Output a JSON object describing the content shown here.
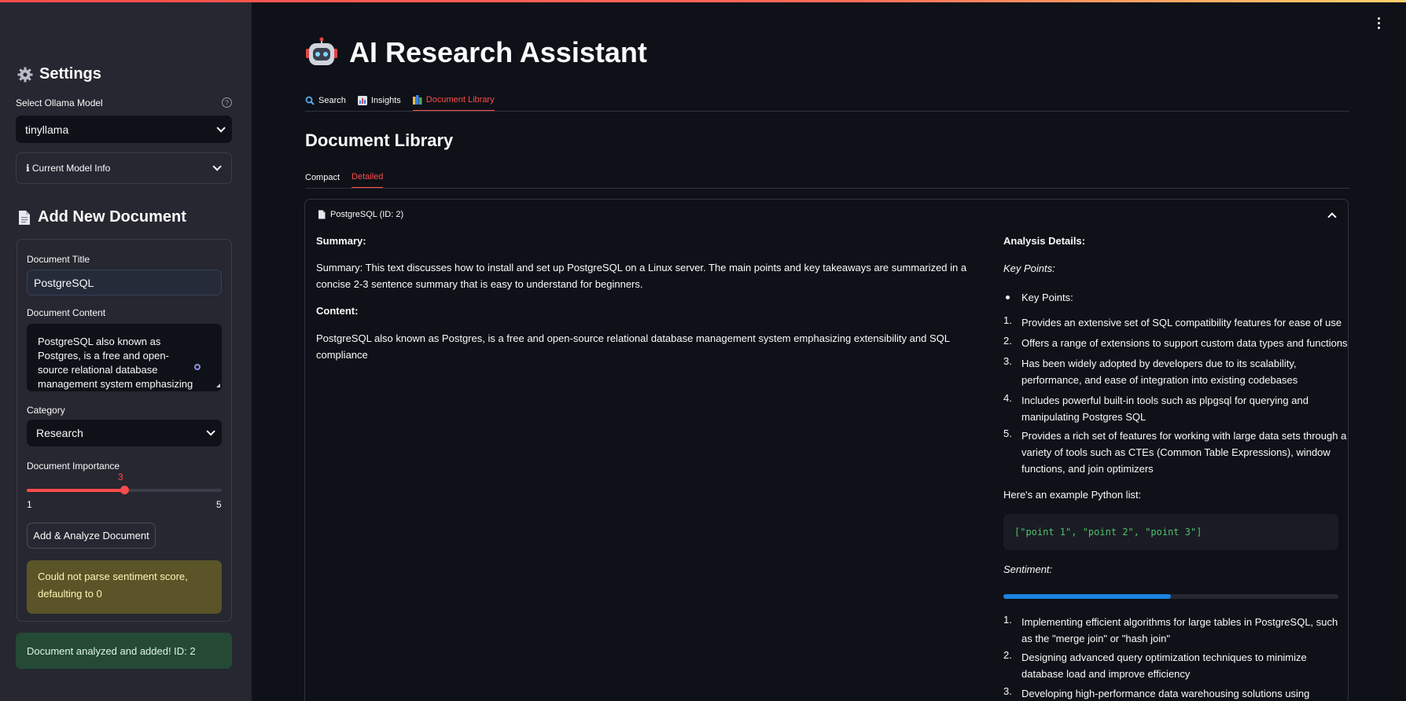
{
  "app": {
    "title": "AI Research Assistant",
    "accent_color": "#ff4b4b"
  },
  "sidebar": {
    "settings_heading": "Settings",
    "model_label": "Select Ollama Model",
    "model_value": "tinyllama",
    "model_info_label": "ℹ Current Model Info",
    "add_heading": "Add New Document",
    "doc_title_label": "Document Title",
    "doc_title_value": "PostgreSQL",
    "doc_content_label": "Document Content",
    "doc_content_value": "PostgreSQL also known as Postgres, is a free and open-source relational database management system emphasizing extensibility and SQL compliance",
    "category_label": "Category",
    "category_value": "Research",
    "importance_label": "Document Importance",
    "importance_value": "3",
    "importance_min": "1",
    "importance_max": "5",
    "importance_fraction": 0.5,
    "add_button": "Add & Analyze Document",
    "warning": "Could not parse sentiment score, defaulting to 0",
    "success": "Document analyzed and added! ID: 2"
  },
  "main": {
    "tabs": [
      {
        "label": "Search",
        "icon": "magnifier-icon"
      },
      {
        "label": "Insights",
        "icon": "bar-chart-icon"
      },
      {
        "label": "Document Library",
        "icon": "books-icon"
      }
    ],
    "section_title": "Document Library",
    "subtabs": [
      "Compact",
      "Detailed"
    ],
    "document": {
      "header": "PostgreSQL (ID: 2)",
      "summary_label": "Summary:",
      "summary_text": "Summary: This text discusses how to install and set up PostgreSQL on a Linux server. The main points and key takeaways are summarized in a concise 2-3 sentence summary that is easy to understand for beginners.",
      "content_label": "Content:",
      "content_text": "PostgreSQL also known as Postgres, is a free and open-source relational database management system emphasizing extensibility and SQL compliance",
      "analysis_label": "Analysis Details:",
      "key_points_label": "Key Points:",
      "key_points_bullet": "Key Points:",
      "key_points": [
        "Provides an extensive set of SQL compatibility features for ease of use",
        "Offers a range of extensions to support custom data types and functions",
        "Has been widely adopted by developers due to its scalability, performance, and ease of integration into existing codebases",
        "Includes powerful built-in tools such as plpgsql for querying and manipulating Postgres SQL",
        "Provides a rich set of features for working with large data sets through a variety of tools such as CTEs (Common Table Expressions), window functions, and join optimizers"
      ],
      "example_intro": "Here's an example Python list:",
      "code": "[\"point 1\", \"point 2\", \"point 3\"]",
      "sentiment_label": "Sentiment:",
      "sentiment_fraction": 0.5,
      "sentiment_items": [
        "Implementing efficient algorithms for large tables in PostgreSQL, such as the \"merge join\" or \"hash join\"",
        "Designing advanced query optimization techniques to minimize database load and improve efficiency",
        "Developing high-performance data warehousing solutions using"
      ]
    }
  }
}
